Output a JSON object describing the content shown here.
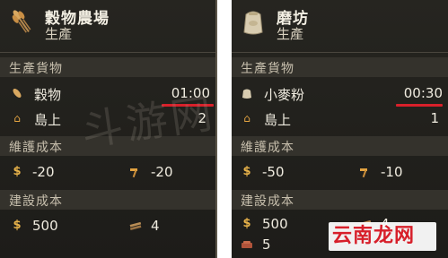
{
  "left_panel": {
    "title": "穀物農場",
    "subtitle": "生產",
    "sections": {
      "production": "生產貨物",
      "maintenance": "維護成本",
      "construction": "建設成本"
    },
    "production": {
      "item_name": "穀物",
      "time": "01:00",
      "island_label": "島上",
      "island_count": "2"
    },
    "maintenance": {
      "coins": "-20",
      "workforce": "-20"
    },
    "construction": {
      "coins": "500",
      "timber": "4"
    }
  },
  "right_panel": {
    "title": "磨坊",
    "subtitle": "生產",
    "sections": {
      "production": "生產貨物",
      "maintenance": "維護成本",
      "construction": "建設成本"
    },
    "production": {
      "item_name": "小麥粉",
      "time": "00:30",
      "island_label": "島上",
      "island_count": "1"
    },
    "maintenance": {
      "coins": "-50",
      "workforce": "-10"
    },
    "construction": {
      "coins": "500",
      "timber": "4",
      "bricks": "5"
    }
  },
  "overlays": {
    "watermark_text": "斗游网",
    "site_logo": "云南龙网"
  },
  "colors": {
    "panel_bg": "#1f1e1b",
    "section_bg": "#34322c",
    "highlight_underline": "#d8202a",
    "coin_gold": "#e8b34a"
  },
  "icons": {
    "left_header": "wheat-sheaf-icon",
    "right_header": "flour-sack-icon",
    "coin": "coin-icon",
    "island": "house-icon",
    "workforce": "hammer-icon",
    "timber": "timber-icon",
    "bricks": "bricks-icon"
  }
}
